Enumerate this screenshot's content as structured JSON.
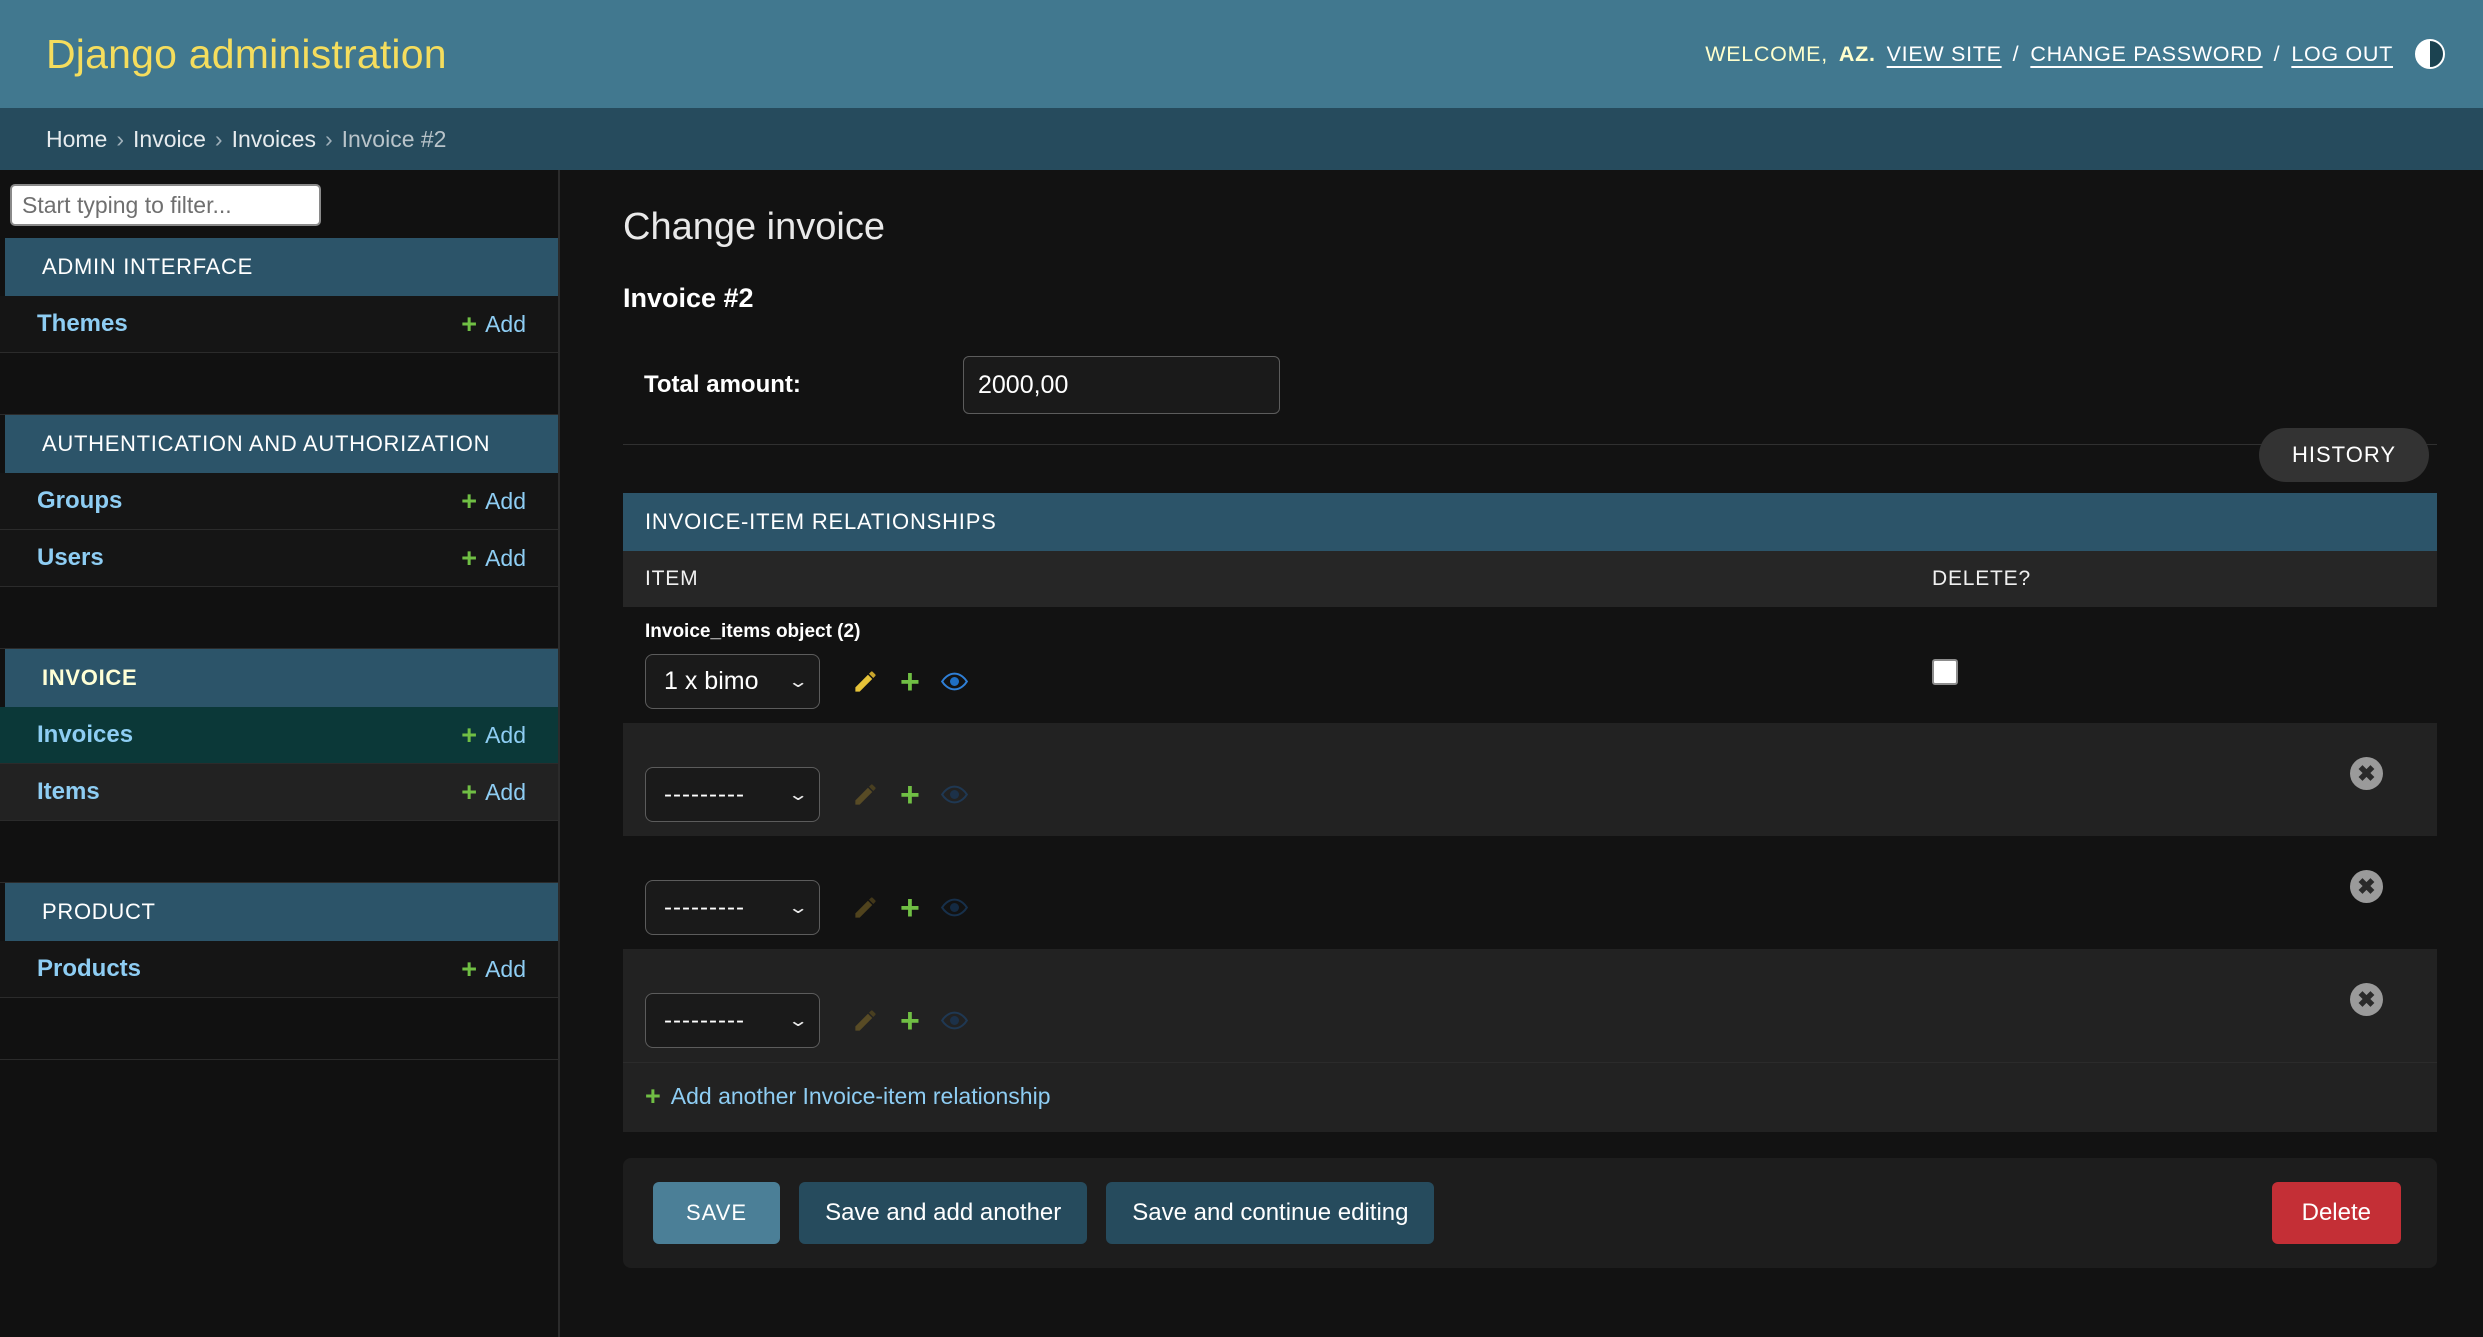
{
  "header": {
    "brand": "Django administration",
    "welcome_prefix": "WELCOME,",
    "username": "AZ.",
    "view_site": "VIEW SITE",
    "sep1": "/",
    "change_password": "CHANGE PASSWORD",
    "sep2": "/",
    "log_out": "LOG OUT",
    "theme_toggle_icon": "theme-toggle-icon"
  },
  "breadcrumbs": {
    "home": "Home",
    "sep1": "›",
    "app": "Invoice",
    "sep2": "›",
    "model": "Invoices",
    "sep3": "›",
    "current": "Invoice #2"
  },
  "sidebar": {
    "filter_placeholder": "Start typing to filter...",
    "add_label": "Add",
    "apps": [
      {
        "title": "ADMIN INTERFACE",
        "accent": false,
        "models": [
          {
            "name": "Themes",
            "current": false
          }
        ]
      },
      {
        "title": "AUTHENTICATION AND AUTHORIZATION",
        "accent": false,
        "models": [
          {
            "name": "Groups",
            "current": false
          },
          {
            "name": "Users",
            "current": false
          }
        ]
      },
      {
        "title": "INVOICE",
        "accent": true,
        "models": [
          {
            "name": "Invoices",
            "current": true
          },
          {
            "name": "Items",
            "current": false
          }
        ]
      },
      {
        "title": "PRODUCT",
        "accent": false,
        "models": [
          {
            "name": "Products",
            "current": false
          }
        ]
      }
    ]
  },
  "main": {
    "page_title": "Change invoice",
    "object_title": "Invoice #2",
    "history_button": "HISTORY",
    "fields": [
      {
        "label": "Total amount:",
        "value": "2000,00"
      }
    ],
    "inline": {
      "heading": "INVOICE-ITEM RELATIONSHIPS",
      "columns": {
        "item": "ITEM",
        "delete": "DELETE?"
      },
      "empty_option": "---------",
      "rows": [
        {
          "object_label": "Invoice_items object (2)",
          "selected": "1 x bimo",
          "has_delete_checkbox": true,
          "has_remove_button": false,
          "icons_dim": false
        },
        {
          "object_label": "",
          "selected": "---------",
          "has_delete_checkbox": false,
          "has_remove_button": true,
          "icons_dim": true
        },
        {
          "object_label": "",
          "selected": "---------",
          "has_delete_checkbox": false,
          "has_remove_button": true,
          "icons_dim": true
        },
        {
          "object_label": "",
          "selected": "---------",
          "has_delete_checkbox": false,
          "has_remove_button": true,
          "icons_dim": true
        }
      ],
      "add_another": "Add another Invoice-item relationship",
      "remove_icon": "✖"
    },
    "submit": {
      "save": "SAVE",
      "save_add_another": "Save and add another",
      "save_continue": "Save and continue editing",
      "delete": "Delete"
    }
  },
  "colors": {
    "header_bg": "#41788f",
    "brand": "#f5dd5d",
    "breadcrumb_bg": "#264b5d",
    "section_bg": "#2c5469",
    "link": "#8ecdf3",
    "plus_green": "#70bf44",
    "save_btn": "#4b7f97",
    "delete_btn": "#c42f36",
    "current_row": "#0b3838"
  }
}
